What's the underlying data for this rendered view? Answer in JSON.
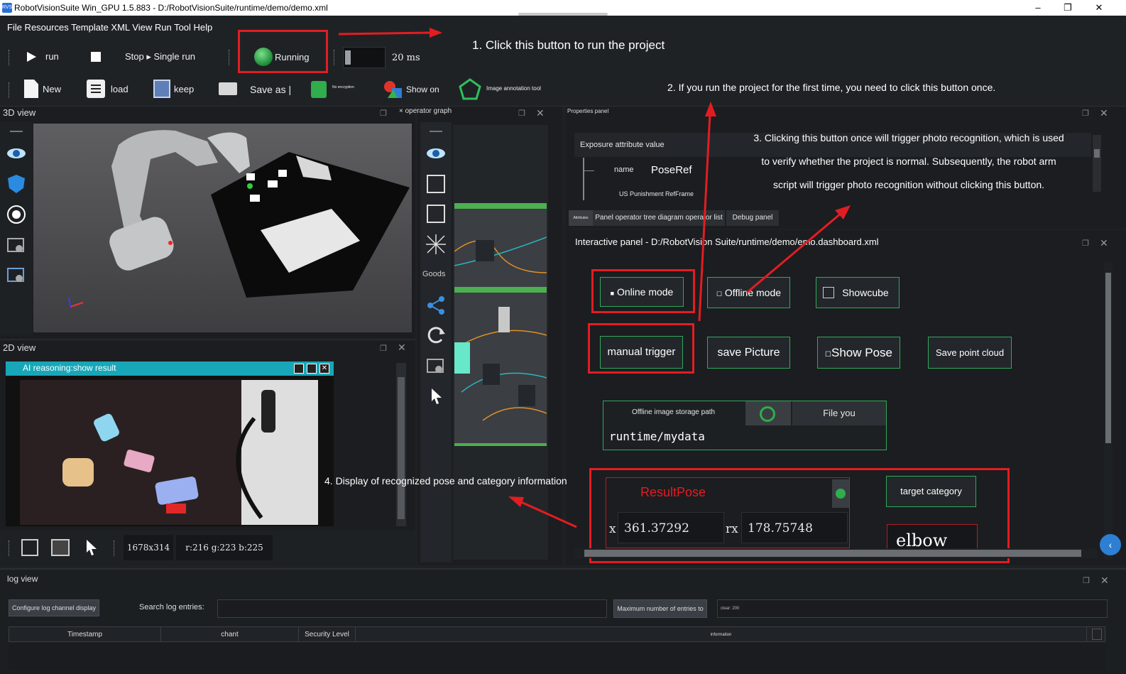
{
  "window": {
    "title": "RobotVisionSuite Win_GPU 1.5.883 - D:/RobotVisionSuite/runtime/demo/demo.xml",
    "app_icon": "RVS",
    "controls": [
      "–",
      "❐",
      "✕"
    ]
  },
  "menu": {
    "text": "File Resources Template XML View Run Tool Help"
  },
  "toolbar1": {
    "run": "run",
    "stop_single": "Stop ▸ Single run",
    "running": "Running",
    "interval": "20 ms"
  },
  "toolbar2": {
    "new": "New",
    "load": "load",
    "keep": "keep",
    "save_as": "Save as |",
    "no_encryption": "No encryption",
    "show_on": "Show on",
    "image_annotation": "Image annotation tool"
  },
  "annotations": {
    "a1": "1. Click this button to run the project",
    "a2": "2. If you run the project for the first time, you need to click this button once.",
    "a3_line1": "3. Clicking this button once will trigger photo recognition, which is used",
    "a3_line2": "to verify whether the project is normal. Subsequently, the robot arm",
    "a3_line3": "script will trigger photo recognition without clicking this button.",
    "a4": "4. Display of recognized pose and category information"
  },
  "view3d": {
    "title": "3D view"
  },
  "view2d": {
    "title": "2D view",
    "window_title": "AI reasoning:show result",
    "resolution": "1678x314",
    "pixel": "r:216 g:223 b:225"
  },
  "operator_graph": {
    "title": "× operator graph",
    "goods": "Goods"
  },
  "properties": {
    "title": "Properties panel",
    "header": "Exposure attribute value",
    "name_label": "name",
    "name_value": "PoseRef",
    "sub_row": "US Punishment RefFrame",
    "tabs": [
      "Attributes",
      "Panel operator tree diagram operator list",
      "Debug panel"
    ]
  },
  "interactive": {
    "title": "Interactive panel - D:/RobotVision Suite/runtime/demo/emo.dashboard.xml",
    "online_mode": "Online mode",
    "offline_mode": "Offline mode",
    "showcube": "Showcube",
    "manual_trigger": "manual trigger",
    "save_picture": "save Picture",
    "show_pose": "Show Pose",
    "save_point_cloud": "Save point cloud",
    "storage_label": "Offline image storage path",
    "file_you": "File you",
    "storage_path": "runtime/mydata",
    "result_pose": "ResultPose",
    "x_label": "x",
    "x_value": "361.37292",
    "rx_label": "rx",
    "rx_value": "178.75748",
    "target_category": "target category",
    "category_value": "elbow"
  },
  "log": {
    "title": "log view",
    "configure": "Configure log channel display",
    "search_label": "Search log entries:",
    "max_label": "Maximum number of entries to",
    "max_value": "clear: 200",
    "columns": [
      "Timestamp",
      "chant",
      "Security Level",
      "information"
    ]
  },
  "colors": {
    "accent_red": "#e21d22",
    "accent_green": "#31a85a",
    "cyan": "#18a7b8",
    "panel": "#1f2225"
  }
}
